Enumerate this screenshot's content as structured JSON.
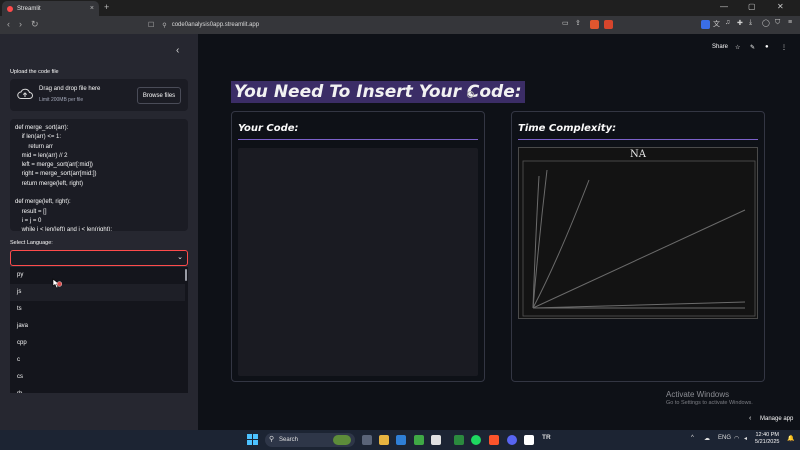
{
  "browser": {
    "tab_title": "Streamlit",
    "tab_close": "×",
    "new_tab": "+",
    "url": "code0analysis0app.streamlit.app",
    "back_icon": "arrow-left",
    "forward_icon": "arrow-right",
    "reload_icon": "reload",
    "window_controls": [
      "—",
      "▢",
      "✕"
    ]
  },
  "sidebar": {
    "collapse_icon": "‹",
    "upload_label": "Upload the code file",
    "dropzone_title": "Drag and drop file here",
    "dropzone_limit": "Limit 200MB per file",
    "browse_button": "Browse files",
    "code_text": "def merge_sort(arr):\n    if len(arr) <= 1:\n        return arr\n    mid = len(arr) // 2\n    left = merge_sort(arr[:mid])\n    right = merge_sort(arr[mid:])\n    return merge(left, right)\n\ndef merge(left, right):\n    result = []\n    i = j = 0\n    while i < len(left) and j < len(right):",
    "language_label": "Select Language:",
    "language_options": [
      "py",
      "js",
      "ts",
      "java",
      "cpp",
      "c",
      "cs",
      "rb"
    ]
  },
  "main": {
    "share_label": "Share",
    "title": "You Need To Insert Your Code:",
    "code_panel_title": "Your Code:",
    "complexity_panel_title": "Time Complexity:",
    "plot_title": "NA",
    "plot_colors": {
      "background": "#131313",
      "lines": "#6b6b6b"
    }
  },
  "watermark": {
    "line1": "Activate Windows",
    "line2": "Go to Settings to activate Windows."
  },
  "manage_app": "Manage app",
  "taskbar": {
    "search_placeholder": "Search",
    "language": "ENG",
    "time": "12:40 PM",
    "date": "5/21/2025",
    "tr_label": "TR"
  },
  "colors": {
    "accent": "#ff4b4b",
    "title_highlight": "#3b2d66",
    "rule": "#7b61c9",
    "sidebar_bg": "#262730",
    "main_bg": "#0e1117"
  }
}
